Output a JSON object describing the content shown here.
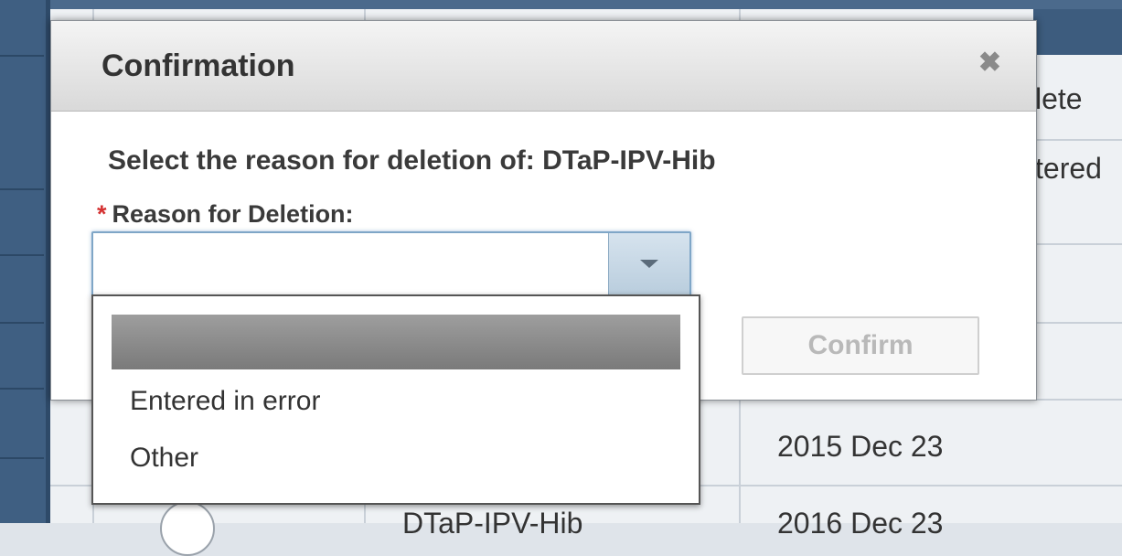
{
  "background": {
    "header_text": "lete",
    "row_text": "tered",
    "date_1": "2015 Dec 23",
    "vaccine_partial": "DTaP-IPV-Hib",
    "date_2_partial": "2016 Dec 23"
  },
  "modal": {
    "title": "Confirmation",
    "close_glyph": "✖",
    "prompt": "Select the reason for deletion of: DTaP-IPV-Hib",
    "field_required_marker": "*",
    "field_label": "Reason for Deletion:",
    "select_value": "",
    "confirm_label": "Confirm"
  },
  "dropdown": {
    "options": [
      "",
      "Entered in error",
      "Other"
    ]
  },
  "colors": {
    "accent": "#7fa6c7",
    "required": "#d43131",
    "rail": "#3f5f82"
  }
}
